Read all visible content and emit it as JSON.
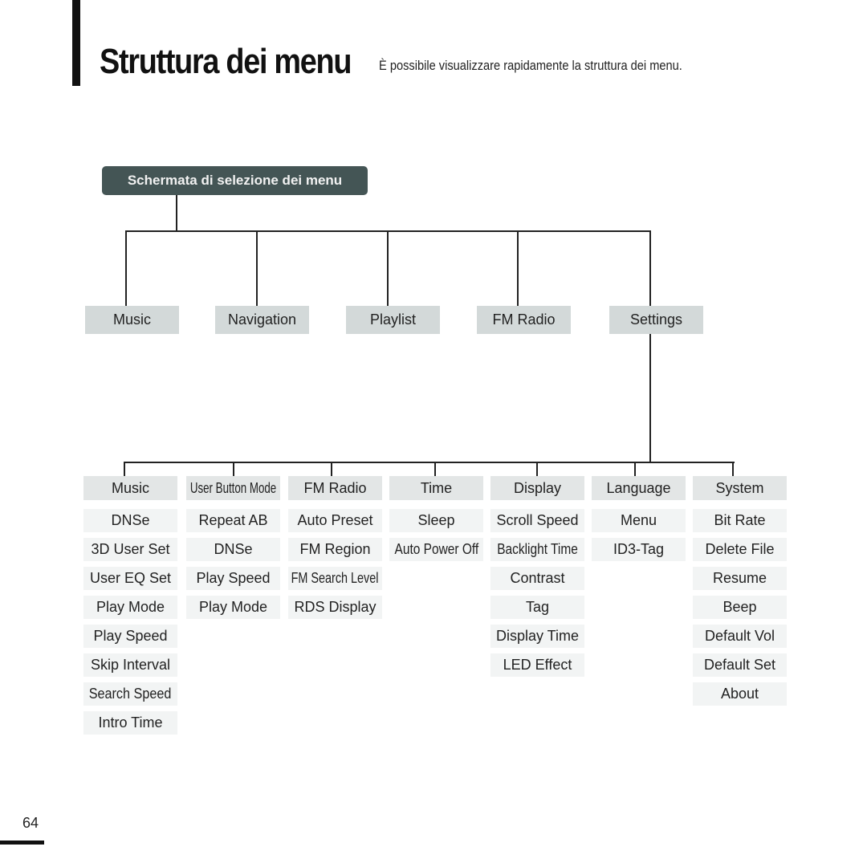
{
  "header": {
    "title": "Struttura dei menu",
    "subtitle": "È possibile visualizzare rapidamente la struttura dei menu."
  },
  "root": {
    "label": "Schermata di selezione dei menu"
  },
  "top_level": [
    {
      "label": "Music"
    },
    {
      "label": "Navigation"
    },
    {
      "label": "Playlist"
    },
    {
      "label": "FM Radio"
    },
    {
      "label": "Settings"
    }
  ],
  "settings_submenus": [
    {
      "label": "Music",
      "items": [
        "DNSe",
        "3D User Set",
        "User EQ Set",
        "Play Mode",
        "Play Speed",
        "Skip Interval",
        "Search Speed",
        "Intro Time"
      ]
    },
    {
      "label": "User Button Mode",
      "items": [
        "Repeat AB",
        "DNSe",
        "Play Speed",
        "Play Mode"
      ]
    },
    {
      "label": "FM Radio",
      "items": [
        "Auto Preset",
        "FM Region",
        "FM Search Level",
        "RDS Display"
      ]
    },
    {
      "label": "Time",
      "items": [
        "Sleep",
        "Auto Power Off"
      ]
    },
    {
      "label": "Display",
      "items": [
        "Scroll Speed",
        "Backlight Time",
        "Contrast",
        "Tag",
        "Display Time",
        "LED Effect"
      ]
    },
    {
      "label": "Language",
      "items": [
        "Menu",
        "ID3-Tag"
      ]
    },
    {
      "label": "System",
      "items": [
        "Bit Rate",
        "Delete File",
        "Resume",
        "Beep",
        "Default Vol",
        "Default Set",
        "About"
      ]
    }
  ],
  "colors": {
    "root_bg": "#445555",
    "top_box_bg": "#d3d9d9",
    "header_box_bg": "#e3e6e6",
    "item_box_bg": "#f2f4f4",
    "line": "#222222"
  },
  "footer": {
    "page_number": "64"
  }
}
